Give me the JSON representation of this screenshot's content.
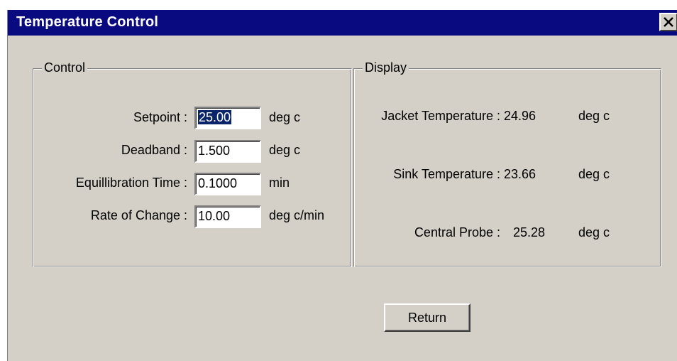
{
  "window": {
    "title": "Temperature Control",
    "close_symbol": "×"
  },
  "control": {
    "legend": "Control",
    "fields": [
      {
        "label": "Setpoint :",
        "value": "25.00",
        "unit": "deg c",
        "selected": true
      },
      {
        "label": "Deadband :",
        "value": "1.500",
        "unit": "deg c"
      },
      {
        "label": "Equillibration Time :",
        "value": "0.1000",
        "unit": "min"
      },
      {
        "label": "Rate of Change :",
        "value": "10.00",
        "unit": "deg c/min"
      }
    ]
  },
  "display": {
    "legend": "Display",
    "readings": [
      {
        "label": "Jacket Temperature :",
        "value": "24.96",
        "unit": "deg c"
      },
      {
        "label": "Sink Temperature :",
        "value": "23.66",
        "unit": "deg c"
      },
      {
        "label": "Central Probe :",
        "value": "25.28",
        "unit": "deg c"
      }
    ]
  },
  "buttons": {
    "return_label": "Return"
  },
  "colors": {
    "titlebar": "#0a0a80",
    "face": "#d4d0c8",
    "selection": "#0a246a"
  },
  "icons": {
    "close": "close-icon"
  }
}
